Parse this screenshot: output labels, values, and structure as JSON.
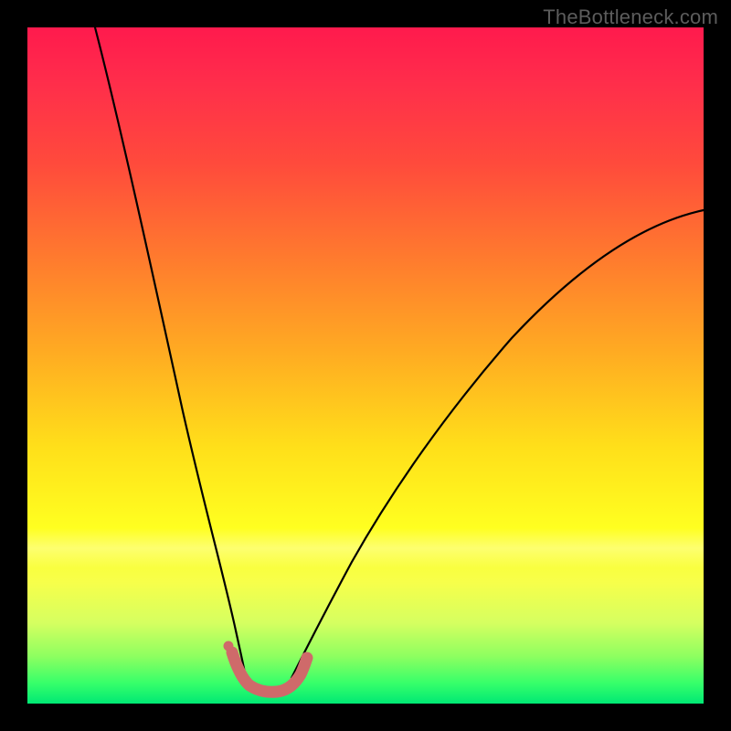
{
  "watermark": {
    "text": "TheBottleneck.com"
  },
  "chart_data": {
    "type": "line",
    "title": "",
    "xlabel": "",
    "ylabel": "",
    "xlim": [
      0,
      100
    ],
    "ylim": [
      0,
      100
    ],
    "grid": false,
    "legend": false,
    "series": [
      {
        "name": "left-branch",
        "color": "#000000",
        "x": [
          10,
          12,
          14,
          16,
          18,
          20,
          22,
          24,
          26,
          28,
          29,
          30,
          31,
          31.5,
          32
        ],
        "y": [
          100,
          90,
          80,
          69,
          58,
          47,
          37,
          28,
          20,
          13,
          10,
          7.5,
          5.5,
          4.2,
          3.5
        ]
      },
      {
        "name": "right-branch",
        "color": "#000000",
        "x": [
          39,
          40,
          42,
          45,
          49,
          54,
          60,
          67,
          75,
          84,
          93,
          100
        ],
        "y": [
          3.5,
          4.5,
          7,
          12,
          19,
          27,
          36,
          45,
          54,
          62,
          68.5,
          73
        ]
      },
      {
        "name": "trough",
        "color": "#cf6a6a",
        "x": [
          30.2,
          30.6,
          31.2,
          32,
          33,
          34.2,
          35.5,
          37,
          38.2,
          39.2,
          40.2,
          41
        ],
        "y": [
          7.6,
          5.8,
          4.1,
          3.0,
          2.5,
          2.3,
          2.3,
          2.6,
          3.1,
          4.0,
          5.4,
          7.3
        ]
      },
      {
        "name": "left-dot",
        "color": "#cf6a6a",
        "type": "scatter",
        "x": [
          29.7
        ],
        "y": [
          8.5
        ]
      }
    ],
    "background_gradient": {
      "direction": "vertical",
      "stops": [
        {
          "pos": 0.0,
          "color": "#ff1a4d"
        },
        {
          "pos": 0.2,
          "color": "#ff4a3c"
        },
        {
          "pos": 0.48,
          "color": "#ffab22"
        },
        {
          "pos": 0.74,
          "color": "#ffff20"
        },
        {
          "pos": 0.93,
          "color": "#8eff60"
        },
        {
          "pos": 1.0,
          "color": "#00e874"
        }
      ]
    }
  }
}
